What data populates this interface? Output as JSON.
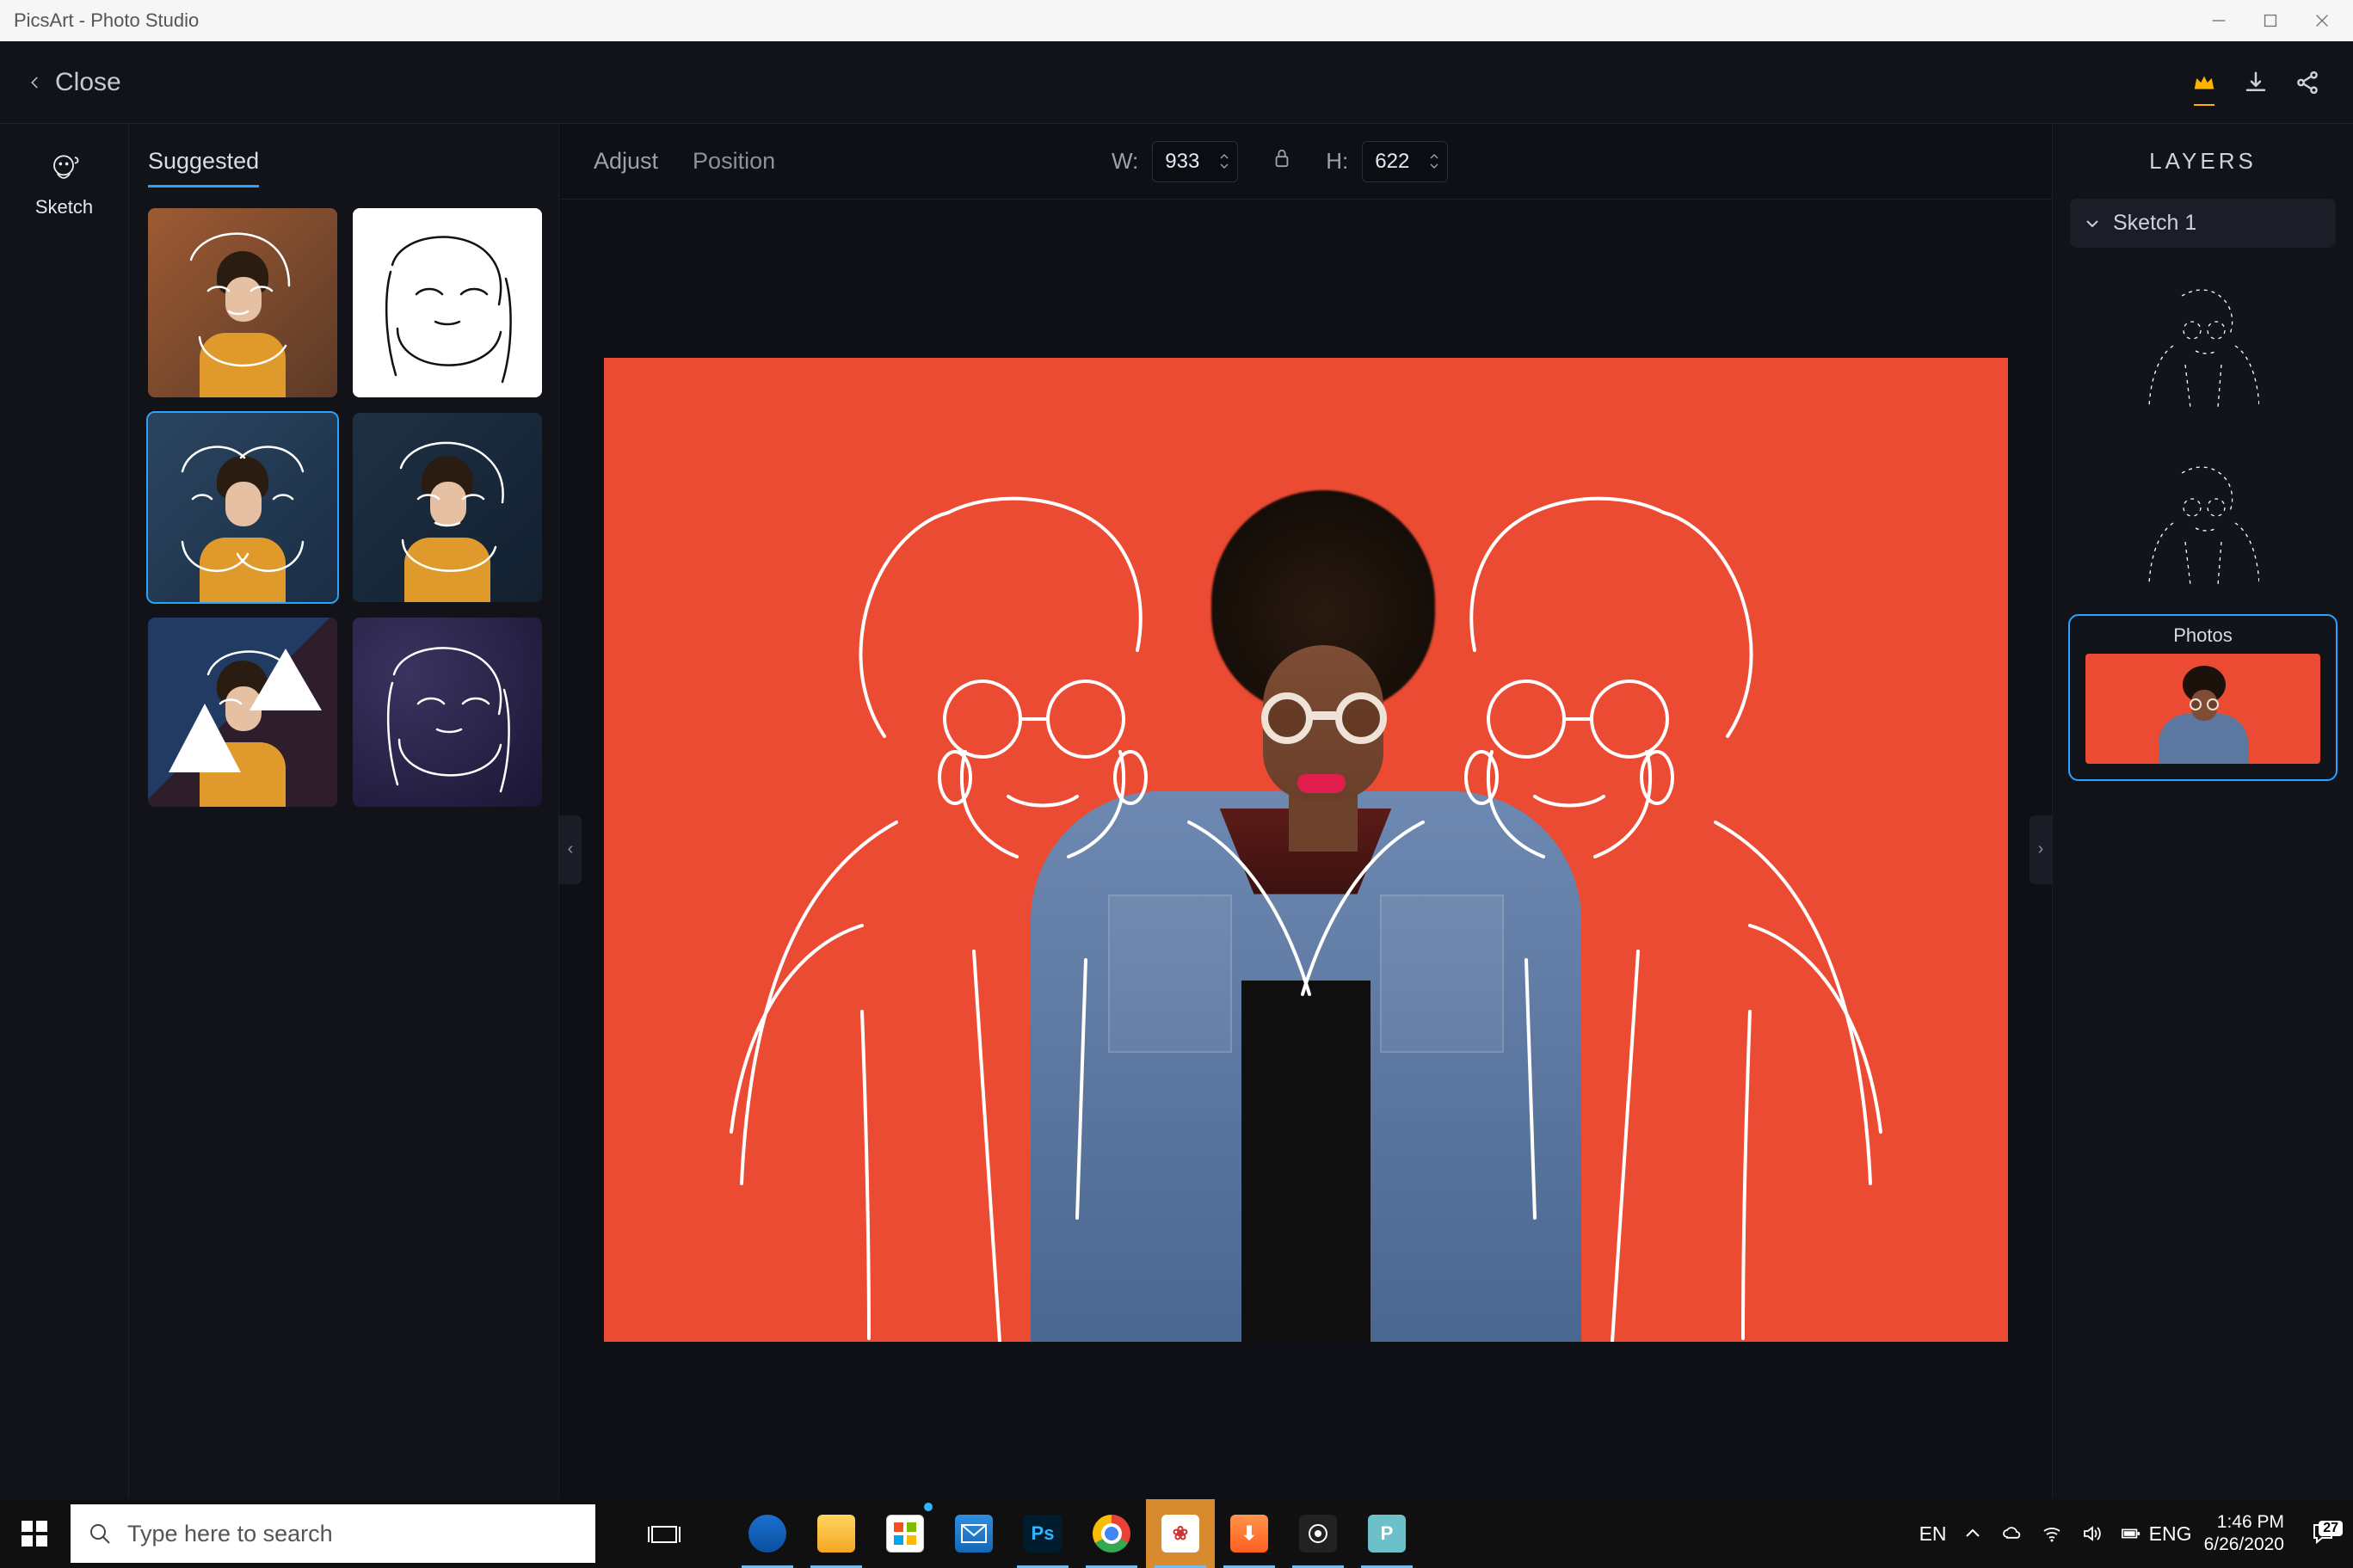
{
  "window": {
    "title": "PicsArt - Photo Studio"
  },
  "header": {
    "close_label": "Close"
  },
  "tool": {
    "sketch_label": "Sketch"
  },
  "suggested": {
    "title": "Suggested"
  },
  "controls": {
    "adjust_label": "Adjust",
    "position_label": "Position",
    "w_label": "W:",
    "h_label": "H:",
    "w_value": "933",
    "h_value": "622"
  },
  "layers": {
    "title": "LAYERS",
    "group_label": "Sketch 1",
    "photos_label": "Photos"
  },
  "taskbar": {
    "search_placeholder": "Type here to search",
    "lang1": "EN",
    "lang2": "ENG",
    "time": "1:46 PM",
    "date": "6/26/2020",
    "notif_count": "27"
  },
  "icons": {
    "chevron_left": "chevron-left-icon",
    "crown": "crown-icon",
    "download": "download-icon",
    "share": "share-icon",
    "sketch": "sketch-tool-icon",
    "lock": "lock-icon"
  }
}
